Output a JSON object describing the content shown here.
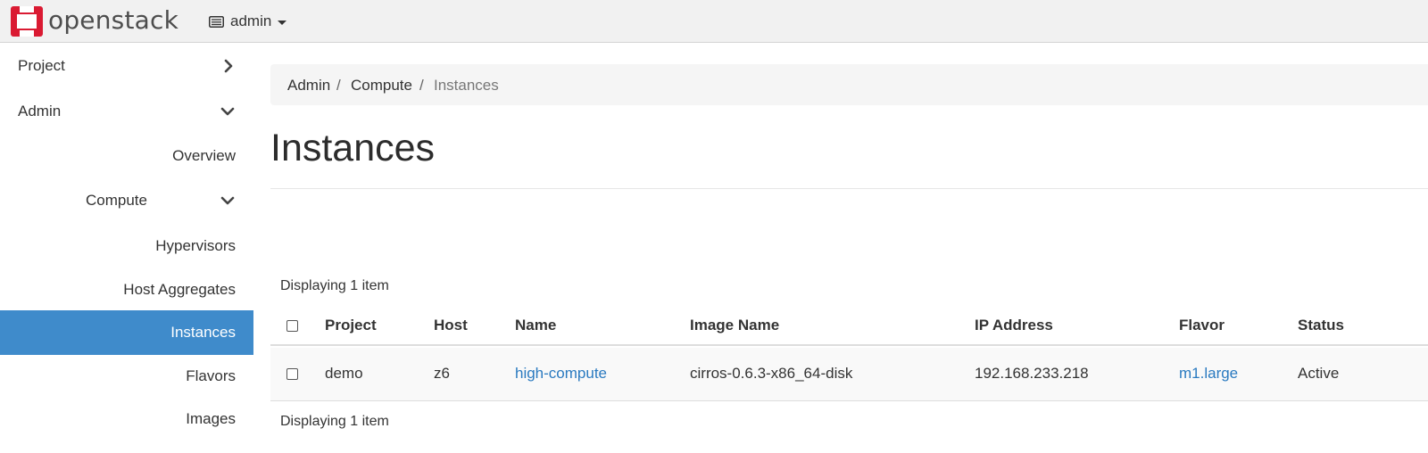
{
  "brand": {
    "name": "openstack"
  },
  "header": {
    "project_switcher": {
      "label": "admin"
    }
  },
  "sidebar": {
    "items": [
      {
        "label": "Project",
        "expanded": false
      },
      {
        "label": "Admin",
        "expanded": true
      },
      {
        "label": "Overview"
      },
      {
        "label": "Compute",
        "expanded": true
      },
      {
        "label": "Hypervisors"
      },
      {
        "label": "Host Aggregates"
      },
      {
        "label": "Instances",
        "active": true
      },
      {
        "label": "Flavors"
      },
      {
        "label": "Images"
      }
    ]
  },
  "breadcrumb": {
    "items": [
      "Admin",
      "Compute"
    ],
    "current": "Instances",
    "separator": "/"
  },
  "page": {
    "title": "Instances"
  },
  "table": {
    "count_top": "Displaying 1 item",
    "count_bottom": "Displaying 1 item",
    "columns": [
      "Project",
      "Host",
      "Name",
      "Image Name",
      "IP Address",
      "Flavor",
      "Status"
    ],
    "rows": [
      {
        "project": "demo",
        "host": "z6",
        "name": "high-compute",
        "image_name": "cirros-0.6.3-x86_64-disk",
        "ip_address": "192.168.233.218",
        "flavor": "m1.large",
        "status": "Active"
      }
    ]
  },
  "colors": {
    "brand_red": "#da1a32",
    "active_nav": "#3f8bcb",
    "link": "#2a7ac0"
  },
  "icons": [
    "openstack-logo",
    "desktop-icon",
    "caret-down-icon",
    "chevron-right-icon",
    "chevron-down-icon",
    "checkbox-icon"
  ]
}
